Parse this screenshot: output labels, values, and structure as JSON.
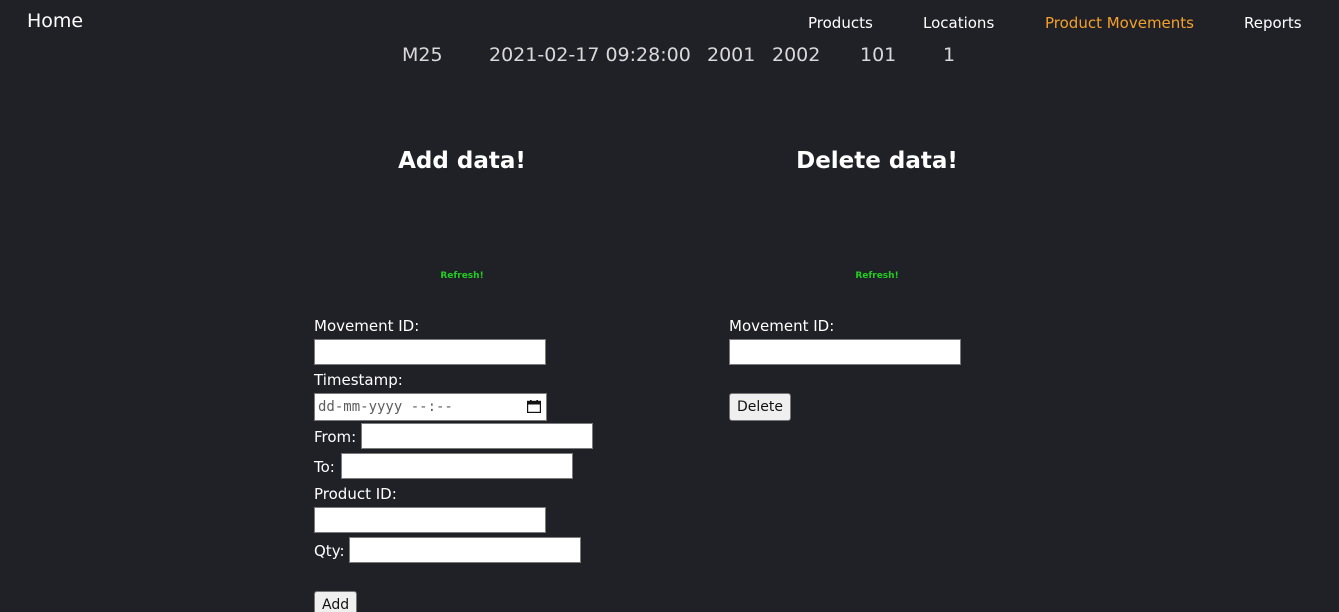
{
  "nav": {
    "brand": "Home",
    "links": [
      {
        "label": "Products",
        "active": false
      },
      {
        "label": "Locations",
        "active": false
      },
      {
        "label": "Product Movements",
        "active": true
      },
      {
        "label": "Reports",
        "active": false
      }
    ]
  },
  "table": {
    "visible_row": [
      "M25",
      "2021-02-17 09:28:00",
      "2001",
      "2002",
      "101",
      "1"
    ]
  },
  "add_section": {
    "title": "Add data!",
    "refresh_label": "Refresh!",
    "fields": {
      "movement_id": {
        "label": "Movement ID:",
        "value": ""
      },
      "timestamp": {
        "label": "Timestamp:",
        "placeholder": "dd-mm-yyyy --:--"
      },
      "from": {
        "label": "From:",
        "value": ""
      },
      "to": {
        "label": "To:",
        "value": ""
      },
      "product_id": {
        "label": "Product ID:",
        "value": ""
      },
      "qty": {
        "label": "Qty:",
        "value": ""
      }
    },
    "submit_label": "Add"
  },
  "delete_section": {
    "title": "Delete data!",
    "refresh_label": "Refresh!",
    "fields": {
      "movement_id": {
        "label": "Movement ID:",
        "value": ""
      }
    },
    "submit_label": "Delete"
  },
  "colors": {
    "background": "#202127",
    "active_link": "#f5a02a",
    "refresh": "#22cc22"
  },
  "icons": [
    "calendar-icon"
  ]
}
